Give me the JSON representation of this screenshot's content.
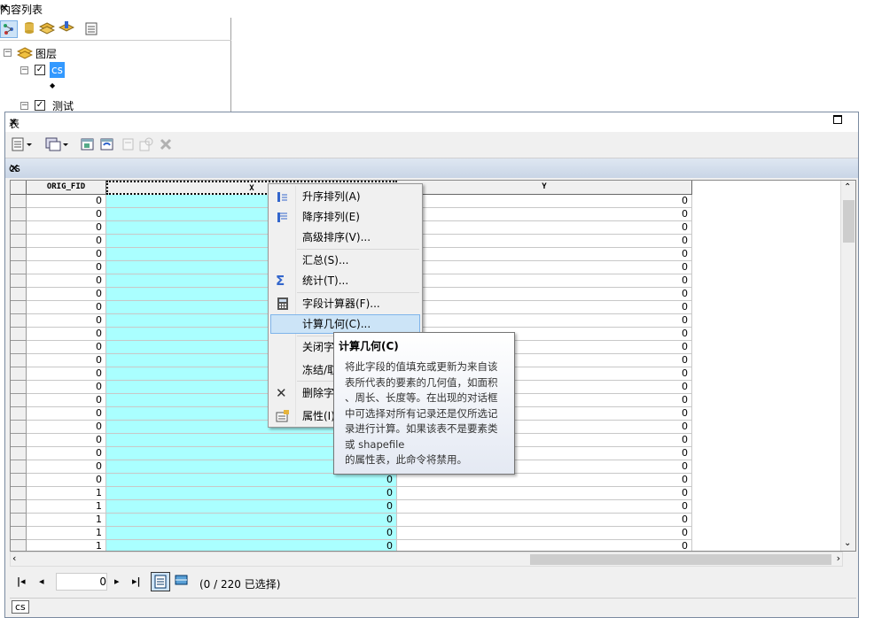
{
  "toc": {
    "title": "内容列表",
    "pin_glyph": "ᵖ",
    "close_glyph": "✕",
    "tree": {
      "group_label": "图层",
      "layer_cs": "cs",
      "layer_test": "测试",
      "symbol": "◆"
    }
  },
  "table_window": {
    "title": "表",
    "close_glyph": "✕",
    "tab_label": "cs",
    "tab_close_glyph": "✕",
    "columns": [
      "ORIG_FID",
      "X",
      "Y"
    ],
    "rows": [
      {
        "orig_fid": "0",
        "x": "",
        "y": "0"
      },
      {
        "orig_fid": "0",
        "x": "",
        "y": "0"
      },
      {
        "orig_fid": "0",
        "x": "",
        "y": "0"
      },
      {
        "orig_fid": "0",
        "x": "",
        "y": "0"
      },
      {
        "orig_fid": "0",
        "x": "",
        "y": "0"
      },
      {
        "orig_fid": "0",
        "x": "",
        "y": "0"
      },
      {
        "orig_fid": "0",
        "x": "",
        "y": "0"
      },
      {
        "orig_fid": "0",
        "x": "",
        "y": "0"
      },
      {
        "orig_fid": "0",
        "x": "",
        "y": "0"
      },
      {
        "orig_fid": "0",
        "x": "",
        "y": "0"
      },
      {
        "orig_fid": "0",
        "x": "",
        "y": "0"
      },
      {
        "orig_fid": "0",
        "x": "",
        "y": "0"
      },
      {
        "orig_fid": "0",
        "x": "",
        "y": "0"
      },
      {
        "orig_fid": "0",
        "x": "",
        "y": "0"
      },
      {
        "orig_fid": "0",
        "x": "",
        "y": "0"
      },
      {
        "orig_fid": "0",
        "x": "",
        "y": "0"
      },
      {
        "orig_fid": "0",
        "x": "",
        "y": "0"
      },
      {
        "orig_fid": "0",
        "x": "",
        "y": "0"
      },
      {
        "orig_fid": "0",
        "x": "",
        "y": "0"
      },
      {
        "orig_fid": "0",
        "x": "",
        "y": "0"
      },
      {
        "orig_fid": "0",
        "x": "",
        "y": "0"
      },
      {
        "orig_fid": "0",
        "x": "0",
        "y": "0"
      },
      {
        "orig_fid": "1",
        "x": "0",
        "y": "0"
      },
      {
        "orig_fid": "1",
        "x": "0",
        "y": "0"
      },
      {
        "orig_fid": "1",
        "x": "0",
        "y": "0"
      },
      {
        "orig_fid": "1",
        "x": "0",
        "y": "0"
      },
      {
        "orig_fid": "1",
        "x": "0",
        "y": "0"
      }
    ],
    "record_position": "0",
    "status_text": "(0 / 220 已选择)",
    "bottom_tab": "cs"
  },
  "context_menu": {
    "items": [
      "升序排列(A)",
      "降序排列(E)",
      "高级排序(V)...",
      "汇总(S)...",
      "统计(T)...",
      "字段计算器(F)...",
      "计算几何(C)...",
      "关闭字",
      "冻结/取",
      "删除字",
      "属性(I)"
    ]
  },
  "tooltip": {
    "title": "计算几何(C)",
    "lines": [
      "将此字段的值填充或更新为来自该",
      "表所代表的要素的几何值，如面积",
      "、周长、长度等。在出现的对话框",
      "中可选择对所有记录还是仅所选记",
      "录进行计算。如果该表不是要素类",
      "或 shapefile",
      "的属性表，此命令将禁用。"
    ]
  },
  "colors": {
    "selected_column": "#aaffff",
    "menu_highlight": "#cce4f7",
    "tab_strip": "#c9d5e6"
  }
}
